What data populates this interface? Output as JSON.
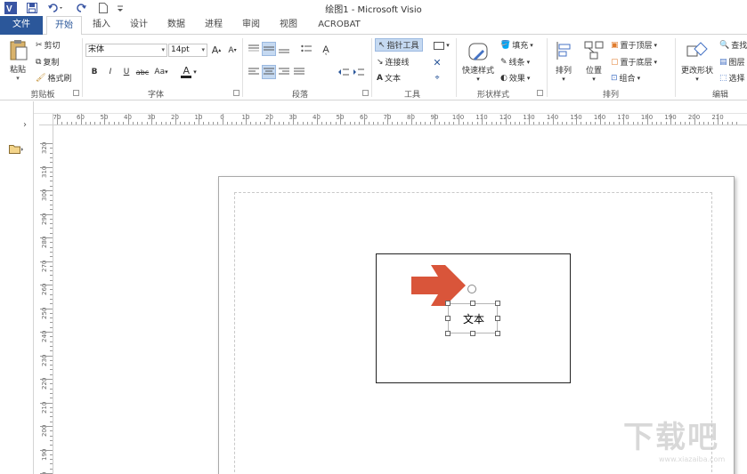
{
  "app": {
    "title": "绘图1 - Microsoft Visio"
  },
  "quick_access": {
    "app_icon": "visio-icon",
    "save_icon": "save-icon",
    "undo_icon": "undo-icon",
    "redo_icon": "redo-icon",
    "new_icon": "new-doc-icon",
    "customize_icon": "customize-icon"
  },
  "tabs": [
    "文件",
    "开始",
    "插入",
    "设计",
    "数据",
    "进程",
    "审阅",
    "视图",
    "ACROBAT"
  ],
  "ribbon": {
    "clipboard": {
      "paste": "粘贴",
      "cut": "剪切",
      "copy": "复制",
      "format_painter": "格式刷",
      "label": "剪贴板"
    },
    "font": {
      "font_name": "宋体",
      "font_size": "14pt",
      "bold": "B",
      "italic": "I",
      "underline": "U",
      "strikethrough": "abc",
      "change_case": "Aa",
      "font_color": "A",
      "grow": "A",
      "shrink": "A",
      "label": "字体"
    },
    "paragraph": {
      "label": "段落"
    },
    "tools": {
      "pointer": "指针工具",
      "connector": "连接线",
      "text": "文本",
      "label": "工具"
    },
    "shape_styles": {
      "quick_styles": "快速样式",
      "fill": "填充",
      "line": "线条",
      "effects": "效果",
      "label": "形状样式"
    },
    "arrange": {
      "align": "排列",
      "position": "位置",
      "bring_front": "置于顶层",
      "send_back": "置于底层",
      "group": "组合",
      "label": "排列"
    },
    "editing": {
      "change_shape": "更改形状",
      "find": "查找",
      "layers": "图层",
      "select": "选择",
      "label": "编辑"
    }
  },
  "rulers": {
    "horizontal": [
      "70",
      "60",
      "50",
      "40",
      "30",
      "20",
      "10",
      "0",
      "10",
      "20",
      "30",
      "40",
      "50",
      "60",
      "70",
      "80",
      "90",
      "100",
      "110",
      "120",
      "130",
      "140",
      "150",
      "160",
      "170",
      "180",
      "190",
      "200",
      "210"
    ],
    "vertical": [
      "320",
      "310",
      "300",
      "290",
      "280",
      "270",
      "260",
      "250",
      "240",
      "230",
      "220",
      "210",
      "200",
      "190",
      "180"
    ]
  },
  "canvas": {
    "textbox_text": "文本"
  },
  "colors": {
    "file_tab": "#2b579a",
    "accent": "#2b579a",
    "arrow": "#d9553a",
    "highlight": "#c5d9f1"
  },
  "watermark": {
    "text": "下载吧",
    "url": "www.xiazaiba.com"
  }
}
